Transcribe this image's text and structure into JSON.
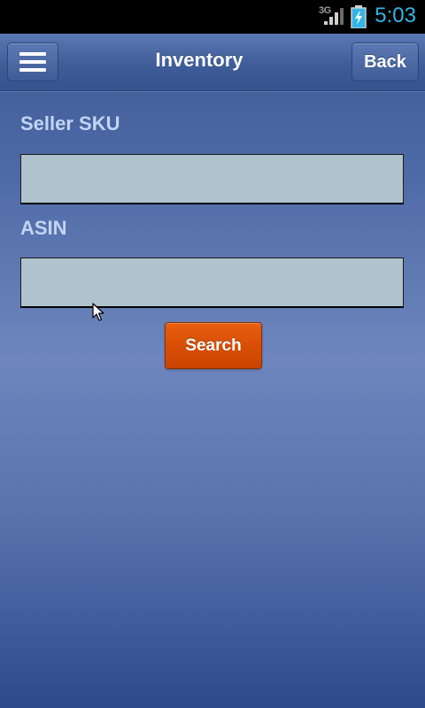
{
  "status_bar": {
    "network": "3G",
    "time": "5:03",
    "icons": [
      "signal-icon",
      "battery-charging-icon"
    ]
  },
  "header": {
    "menu_icon": "hamburger-menu-icon",
    "title": "Inventory",
    "back_label": "Back"
  },
  "form": {
    "seller_sku_label": "Seller SKU",
    "seller_sku_value": "",
    "asin_label": "ASIN",
    "asin_value": "",
    "search_label": "Search"
  },
  "colors": {
    "status_time": "#33b5e5",
    "label": "#c3d5f5",
    "input_bg": "#aec3cc",
    "search_button": "#d94e05",
    "header": "#3f5d99"
  }
}
